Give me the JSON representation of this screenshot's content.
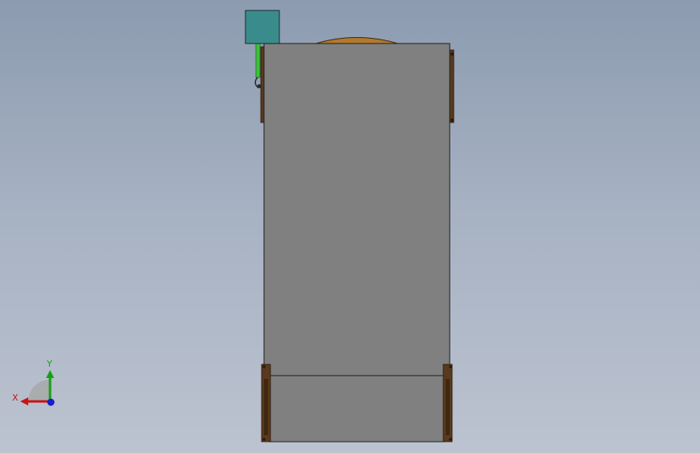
{
  "viewport": {
    "background_top": "#8c9bb0",
    "background_bottom": "#bcc3d0"
  },
  "model": {
    "body_color": "#808080",
    "wood_color": "#5a3a1e",
    "dome_color": "#b07a2e",
    "motor_color": "#3a8c8c",
    "pipe_color": "#3cc43c"
  },
  "triad": {
    "x_label": "X",
    "y_label": "Y",
    "x_color": "#c81414",
    "y_color": "#14a014",
    "z_color": "#1420c8"
  }
}
